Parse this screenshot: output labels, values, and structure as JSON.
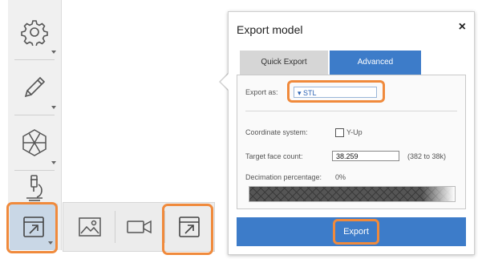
{
  "toolbar": {
    "items": [
      {
        "name": "settings",
        "icon": "gear-icon"
      },
      {
        "name": "edit",
        "icon": "pencil-icon"
      },
      {
        "name": "mesh",
        "icon": "hexagon-mesh-icon"
      },
      {
        "name": "inspect",
        "icon": "microscope-icon"
      },
      {
        "name": "export",
        "icon": "export-icon",
        "active": true
      }
    ]
  },
  "subbar": {
    "items": [
      {
        "name": "image",
        "icon": "image-icon"
      },
      {
        "name": "video",
        "icon": "video-camera-icon"
      },
      {
        "name": "export-model",
        "icon": "export-icon"
      }
    ]
  },
  "panel": {
    "title": "Export model",
    "close": "×",
    "tabs": [
      {
        "label": "Quick Export",
        "active": false
      },
      {
        "label": "Advanced",
        "active": true
      }
    ],
    "export_as_label": "Export as:",
    "export_as_value": "▾ STL",
    "coordinate_label": "Coordinate system:",
    "coordinate_option": "Y-Up",
    "face_count_label": "Target face count:",
    "face_count_value": "38.259",
    "face_count_range": "(382 to 38k)",
    "decimation_label": "Decimation percentage:",
    "decimation_value": "0%",
    "export_button": "Export"
  },
  "colors": {
    "accent": "#3d7cc9",
    "highlight": "#f08a3c",
    "toolbar_bg": "#f0f0f0",
    "active_tool": "#c9d7e6"
  }
}
